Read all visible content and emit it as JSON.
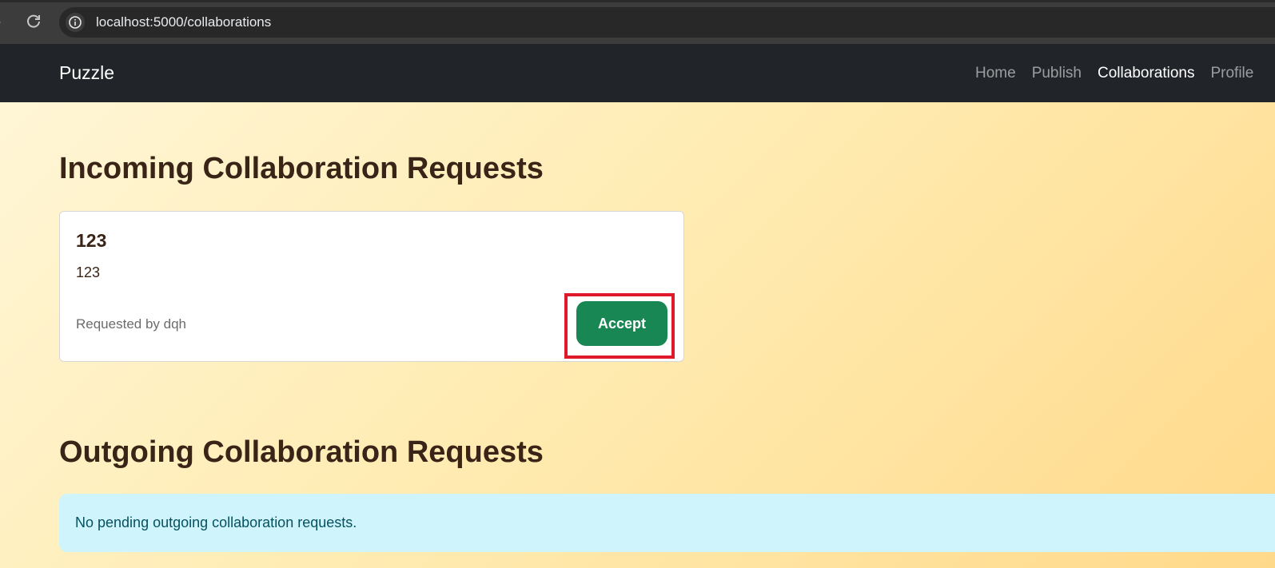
{
  "browser": {
    "url": "localhost:5000/collaborations"
  },
  "navbar": {
    "brand": "Puzzle",
    "links": [
      {
        "label": "Home"
      },
      {
        "label": "Publish"
      },
      {
        "label": "Collaborations",
        "active": true
      },
      {
        "label": "Profile"
      }
    ]
  },
  "incoming": {
    "title": "Incoming Collaboration Requests",
    "requests": [
      {
        "title": "123",
        "description": "123",
        "requested_by": "Requested by dqh",
        "accept_label": "Accept"
      }
    ]
  },
  "outgoing": {
    "title": "Outgoing Collaboration Requests",
    "empty_message": "No pending outgoing collaboration requests."
  },
  "colors": {
    "navbar_bg": "#212529",
    "accept_button": "#198754",
    "highlight_box": "#e0192a",
    "alert_bg": "#cff4fc",
    "heading_text": "#3a2417"
  }
}
